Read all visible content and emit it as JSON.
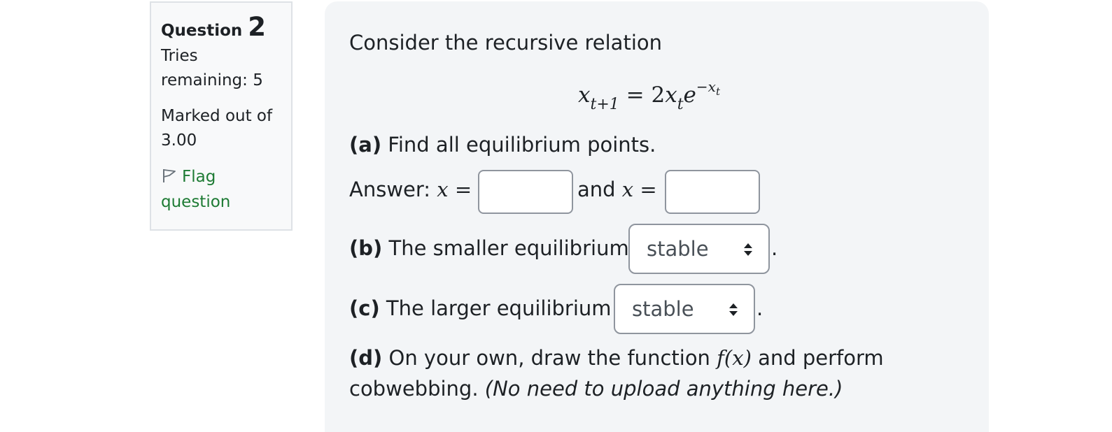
{
  "info": {
    "question_label": "Question",
    "question_number": "2",
    "state_line1": "Tries",
    "state_line2": "remaining: 5",
    "grade_line1": "Marked out of",
    "grade_line2": "3.00",
    "flag_line1": "Flag",
    "flag_line2": "question"
  },
  "question": {
    "intro": "Consider the recursive relation",
    "equation": {
      "lhs_var": "x",
      "lhs_sub": "t+1",
      "equals": "=",
      "coef": "2",
      "var": "x",
      "var_sub": "t",
      "base": "e",
      "exp": "−x",
      "exp_sub": "t"
    },
    "part_a_label": "(a)",
    "part_a_text": "Find all equilibrium points.",
    "answer_label": "Answer:",
    "answer_var1": "x =",
    "answer_and": "and",
    "answer_var2": "x =",
    "answer1_value": "",
    "answer2_value": "",
    "part_b_label": "(b)",
    "part_b_text": "The smaller equilibrium is",
    "part_b_selected": "stable",
    "part_b_period": ".",
    "part_c_label": "(c)",
    "part_c_text": "The larger equilibrium is",
    "part_c_selected": "stable",
    "part_c_period": ".",
    "part_d_label": "(d)",
    "part_d_text1": "On your own, draw the function",
    "part_d_func": "f(x)",
    "part_d_text2": "and perform",
    "part_d_text3": "cobwebbing.",
    "part_d_note": "(No need to upload anything here.)"
  },
  "colors": {
    "flag_link": "#1e7b34",
    "content_bg": "#f3f5f7",
    "info_bg": "#f8f9fa"
  }
}
